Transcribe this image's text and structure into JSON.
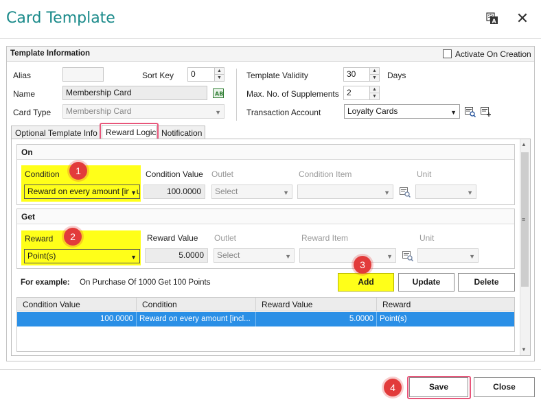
{
  "window": {
    "title": "Card Template",
    "translate_icon": "translate-icon",
    "close_glyph": "✕"
  },
  "template_info": {
    "section_title": "Template Information",
    "activate_label": "Activate On Creation",
    "activate_checked": false,
    "alias_label": "Alias",
    "alias_value": "",
    "sort_key_label": "Sort Key",
    "sort_key_value": "0",
    "name_label": "Name",
    "name_value": "Membership Card",
    "card_type_label": "Card Type",
    "card_type_value": "Membership Card",
    "validity_label": "Template Validity",
    "validity_value": "30",
    "validity_unit": "Days",
    "supplements_label": "Max. No. of Supplements",
    "supplements_value": "2",
    "transaction_label": "Transaction Account",
    "transaction_value": "Loyalty Cards"
  },
  "tabs": [
    {
      "label": "Optional Template Info"
    },
    {
      "label": "Reward Logic"
    },
    {
      "label": "Notification"
    }
  ],
  "on_group": {
    "title": "On",
    "condition_label": "Condition",
    "condition_value": "Reward on every amount [inclu",
    "condition_value_label": "Condition Value",
    "condition_value_value": "100.0000",
    "outlet_label": "Outlet",
    "outlet_value": "Select",
    "condition_item_label": "Condition Item",
    "unit_label": "Unit"
  },
  "get_group": {
    "title": "Get",
    "reward_label": "Reward",
    "reward_value": "Point(s)",
    "reward_value_label": "Reward Value",
    "reward_value_value": "5.0000",
    "outlet_label": "Outlet",
    "outlet_value": "Select",
    "reward_item_label": "Reward Item",
    "unit_label": "Unit"
  },
  "example": {
    "label": "For example:",
    "text": "On Purchase Of 1000 Get 100 Points"
  },
  "actions": {
    "add": "Add",
    "update": "Update",
    "delete": "Delete"
  },
  "grid": {
    "columns": [
      "Condition Value",
      "Condition",
      "Reward Value",
      "Reward"
    ],
    "rows": [
      [
        "100.0000",
        "Reward on every amount [incl...",
        "5.0000",
        "Point(s)"
      ]
    ]
  },
  "footer": {
    "save": "Save",
    "close": "Close"
  },
  "annotations": {
    "badge1": "1",
    "badge2": "2",
    "badge3": "3",
    "badge4": "4"
  },
  "colors": {
    "title": "#1a8a8a",
    "highlight": "#ffff19",
    "selection": "#2a8fe6",
    "badge": "#e23b3b",
    "callout_border": "#e8557a"
  }
}
